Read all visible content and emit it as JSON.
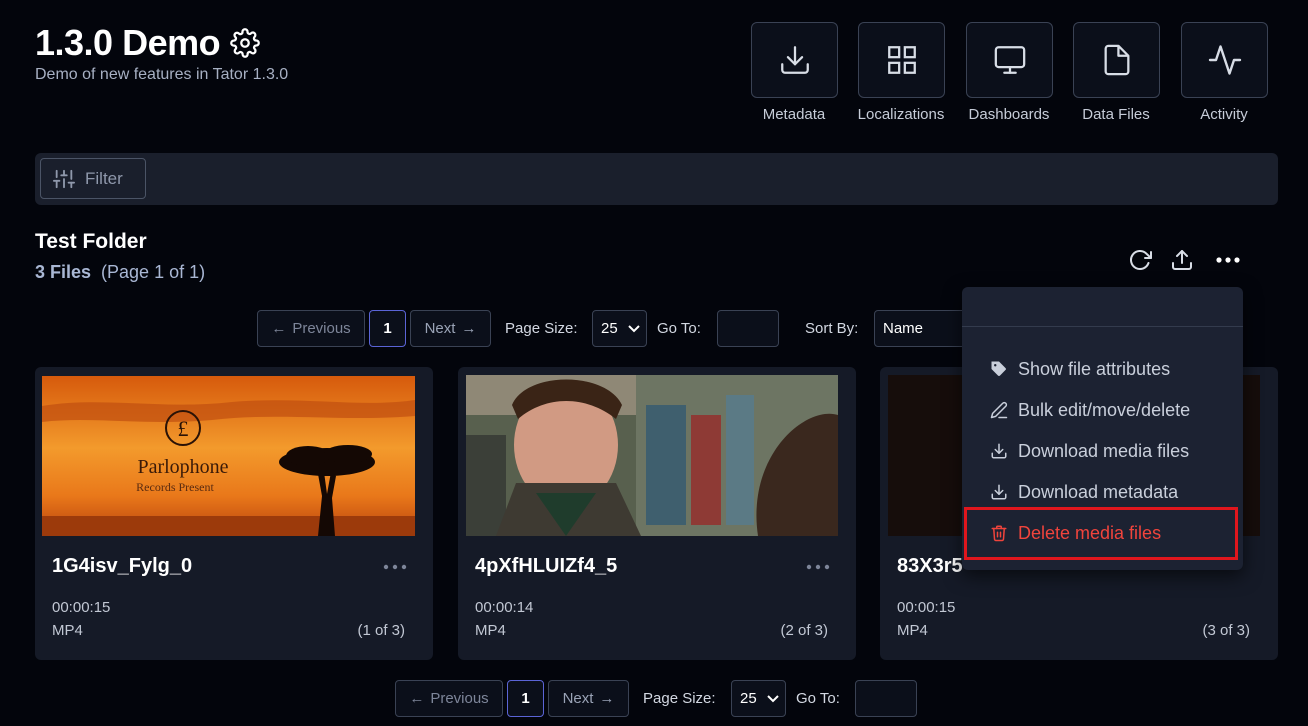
{
  "project": {
    "title": "1.3.0 Demo",
    "description": "Demo of new features in Tator 1.3.0"
  },
  "tools": [
    {
      "label": "Metadata",
      "icon": "download-icon"
    },
    {
      "label": "Localizations",
      "icon": "grid-icon"
    },
    {
      "label": "Dashboards",
      "icon": "monitor-icon"
    },
    {
      "label": "Data Files",
      "icon": "file-icon"
    },
    {
      "label": "Activity",
      "icon": "activity-icon"
    }
  ],
  "filter": {
    "label": "Filter"
  },
  "folder": {
    "name": "Test Folder",
    "count": "3 Files",
    "page_info": "(Page 1 of 1)"
  },
  "pagination": {
    "previous": "Previous",
    "current": "1",
    "next": "Next",
    "page_size_label": "Page Size:",
    "page_size": "25",
    "goto_label": "Go To:",
    "sort_label": "Sort By:",
    "sort_value": "Name"
  },
  "cards": [
    {
      "name": "1G4isv_Fylg_0",
      "duration": "00:00:15",
      "type": "MP4",
      "position": "(1 of 3)"
    },
    {
      "name": "4pXfHLUIZf4_5",
      "duration": "00:00:14",
      "type": "MP4",
      "position": "(2 of 3)"
    },
    {
      "name": "83X3r5",
      "duration": "00:00:15",
      "type": "MP4",
      "position": "(3 of 3)"
    }
  ],
  "thumb1": {
    "brand": "Parlophone",
    "sub": "Records Present"
  },
  "menu": {
    "items": [
      {
        "label": "Show file attributes",
        "icon": "tag-icon"
      },
      {
        "label": "Bulk edit/move/delete",
        "icon": "pencil-icon"
      },
      {
        "label": "Download media files",
        "icon": "download-icon"
      },
      {
        "label": "Download metadata",
        "icon": "download-icon"
      },
      {
        "label": "Delete media files",
        "icon": "trash-icon"
      }
    ]
  },
  "colors": {
    "background": "#03050c",
    "panel": "#1a1f2c",
    "card": "#151a27",
    "danger": "#f0443c",
    "highlight": "#e0161d",
    "accent": "#5b64d6"
  }
}
